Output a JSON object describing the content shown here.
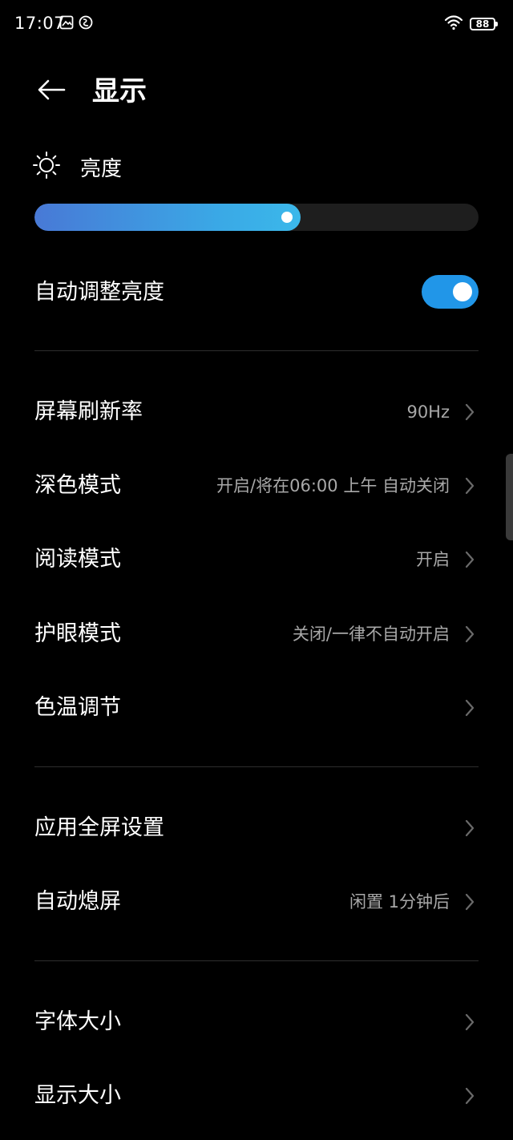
{
  "status_bar": {
    "time": "17:07",
    "battery": "88",
    "left_icons": [
      "gallery-icon",
      "data-saver-icon"
    ],
    "right_icons": [
      "wifi-icon",
      "battery-icon"
    ]
  },
  "header": {
    "title": "显示",
    "back_icon": "arrow-left-icon"
  },
  "brightness": {
    "label": "亮度",
    "icon": "sun-icon",
    "level": 0.6
  },
  "auto_brightness": {
    "label": "自动调整亮度",
    "enabled": true,
    "toggle_color": "#2196e8"
  },
  "sections": [
    {
      "rows": [
        {
          "id": "refresh-rate",
          "label": "屏幕刷新率",
          "value": "90Hz"
        },
        {
          "id": "dark-mode",
          "label": "深色模式",
          "value": "开启/将在06:00 上午 自动关闭"
        },
        {
          "id": "reading-mode",
          "label": "阅读模式",
          "value": "开启"
        },
        {
          "id": "eye-comfort",
          "label": "护眼模式",
          "value": "关闭/一律不自动开启"
        },
        {
          "id": "color-temperature",
          "label": "色温调节",
          "value": ""
        }
      ]
    },
    {
      "rows": [
        {
          "id": "fullscreen-apps",
          "label": "应用全屏设置",
          "value": ""
        },
        {
          "id": "screen-timeout",
          "label": "自动熄屏",
          "value": "闲置 1分钟后"
        }
      ]
    },
    {
      "rows": [
        {
          "id": "font-size",
          "label": "字体大小",
          "value": ""
        },
        {
          "id": "display-size",
          "label": "显示大小",
          "value": ""
        }
      ]
    }
  ],
  "colors": {
    "background": "#000000",
    "text": "#ffffff",
    "secondary_text": "#a8a8a8",
    "accent": "#2196e8",
    "divider": "#2e2e2e"
  }
}
